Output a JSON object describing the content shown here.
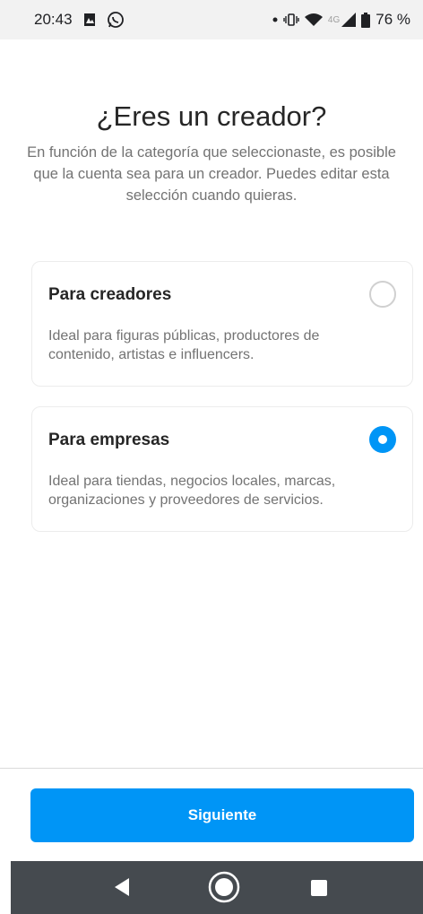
{
  "status_bar": {
    "time": "20:43",
    "network": "4G",
    "battery": "76 %",
    "icons": [
      "gallery-icon",
      "whatsapp-icon",
      "dot-icon",
      "vibrate-icon",
      "wifi-icon",
      "signal-icon",
      "battery-icon"
    ]
  },
  "header": {
    "title": "¿Eres un creador?",
    "subtitle": "En función de la categoría que seleccionaste, es posible que la cuenta sea para un creador. Puedes editar esta selección cuando quieras."
  },
  "options": [
    {
      "title": "Para creadores",
      "description": "Ideal para figuras públicas, productores de contenido, artistas e influencers.",
      "selected": false
    },
    {
      "title": "Para empresas",
      "description": "Ideal para tiendas, negocios locales, marcas, organizaciones y proveedores de servicios.",
      "selected": true
    }
  ],
  "footer": {
    "next_label": "Siguiente"
  },
  "nav_bar": {
    "icons": [
      "back-icon",
      "home-icon",
      "recents-icon"
    ]
  },
  "colors": {
    "accent": "#0095f6",
    "secondary_text": "#737373",
    "nav_bar": "#454a4f"
  }
}
